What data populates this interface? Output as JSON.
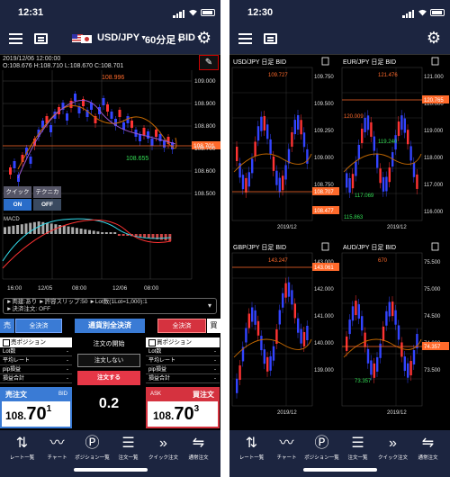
{
  "left": {
    "status_time": "12:31",
    "pair": "USD/JPY",
    "timeframe": "60分足",
    "price_type": "BID",
    "ohlc_line1": "2019/12/06 12:00:00",
    "ohlc_line2": "O:108.676  H:108.710  L:108.670  C:108.701",
    "chart_high_label": "108.996",
    "chart_low_label": "108.655",
    "current_price": "108.701",
    "price_axis": [
      "109.000",
      "108.900",
      "108.800",
      "108.700",
      "108.600",
      "108.500"
    ],
    "time_axis": [
      "16:00",
      "12/05",
      "08:00",
      "12/06",
      "08:00"
    ],
    "quick_order_label": "クイック注文",
    "technical_label": "テクニカル",
    "on_label": "ON",
    "off_label": "OFF",
    "macd_label": "MACD",
    "info_line1": "►両建:あり  ►許容スリップ:50  ►Lot数(1Lot=1,000):1",
    "info_line2": "►決済注文: OFF",
    "sell_tag": "売",
    "sell_close_all": "全決済",
    "close_by_currency": "通貨別全決済",
    "buy_close_all": "全決済",
    "buy_tag": "買",
    "sell_position_title": "売ポジション",
    "buy_position_title": "買ポジション",
    "position_rows": [
      {
        "label": "Lot数",
        "value": "-"
      },
      {
        "label": "平均レート",
        "value": "-"
      },
      {
        "label": "pip損益",
        "value": "-"
      },
      {
        "label": "損益合計",
        "value": "-"
      }
    ],
    "order_start_label": "注文の開始",
    "no_order_button": "注文しない",
    "place_order_button": "注文する",
    "spread": "0.2",
    "sell_order_label": "売注文",
    "bid_label": "BID",
    "bid_price_main": "108.",
    "bid_price_big": "70",
    "bid_price_small": "1",
    "ask_label": "ASK",
    "buy_order_label": "買注文",
    "ask_price_main": "108.",
    "ask_price_big": "70",
    "ask_price_small": "3"
  },
  "right": {
    "status_time": "12:30",
    "charts": [
      {
        "title": "USD/JPY 日足 BID",
        "high": "109.727",
        "price_tag": "108.707",
        "low_tag": "108.477",
        "axis": [
          "109.750",
          "109.500",
          "109.250",
          "109.000",
          "108.750",
          "108.500"
        ],
        "date": "2019/12"
      },
      {
        "title": "EUR/JPY 日足 BID",
        "high": "121.476",
        "mid": "120.009",
        "low2": "119.240",
        "low": "117.069",
        "bottom": "115.863",
        "price_tag": "120.765",
        "axis": [
          "121.000",
          "120.000",
          "119.000",
          "118.000",
          "117.000",
          "116.000"
        ],
        "date": "2019/12"
      },
      {
        "title": "GBP/JPY 日足 BID",
        "high": "143.247",
        "price_tag": "143.061",
        "axis": [
          "143.000",
          "142.000",
          "141.000",
          "140.000",
          "139.000"
        ],
        "date": "2019/12"
      },
      {
        "title": "AUD/JPY 日足 BID",
        "high": "670",
        "low": "73.357",
        "price_tag": "74.357",
        "axis": [
          "75.500",
          "75.000",
          "74.500",
          "74.000",
          "73.500"
        ],
        "date": "2019/12"
      }
    ]
  },
  "nav": [
    {
      "icon": "rate-list-icon",
      "label": "レート一覧"
    },
    {
      "icon": "chart-icon",
      "label": "チャート"
    },
    {
      "icon": "position-icon",
      "label": "ポジション一覧"
    },
    {
      "icon": "order-list-icon",
      "label": "注文一覧"
    },
    {
      "icon": "quick-order-icon",
      "label": "クイック注文"
    },
    {
      "icon": "normal-order-icon",
      "label": "通常注文"
    }
  ],
  "colors": {
    "navy": "#1c2540",
    "sell": "#3a7bd5",
    "buy": "#d5323f",
    "price_line": "#ff6a2b",
    "bull": "#3344ff",
    "bear": "#ff3333"
  }
}
